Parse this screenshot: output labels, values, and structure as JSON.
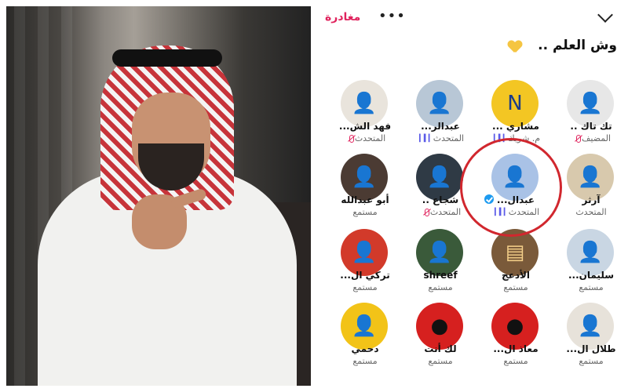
{
  "topbar": {
    "leave_label": "مغادرة",
    "more_label": "•••"
  },
  "space": {
    "title": "وش العلم .."
  },
  "participants": [
    {
      "name": "تك تاك ..",
      "role": "المضيف",
      "status": "muted",
      "avatar_color": "#e7e7e7",
      "avatar_fg": "#444444",
      "avatar_glyph": "👤"
    },
    {
      "name": "مشاري ...",
      "role": "م. شريك",
      "status": "speaking",
      "avatar_color": "#f3c623",
      "avatar_fg": "#1a3c8a",
      "avatar_glyph": "N"
    },
    {
      "name": "عبدالر...",
      "role": "المتحدث",
      "status": "speaking",
      "avatar_color": "#b8c7d6",
      "avatar_fg": "#2a2a2a",
      "avatar_glyph": "👤"
    },
    {
      "name": "فهد الش...",
      "role": "المتحدث",
      "status": "muted",
      "avatar_color": "#e9e4dc",
      "avatar_fg": "#333333",
      "avatar_glyph": "👤"
    },
    {
      "name": "آرثر",
      "role": "المتحدث",
      "status": "none",
      "avatar_color": "#d8c9ad",
      "avatar_fg": "#222222",
      "avatar_glyph": "👤"
    },
    {
      "name": "عبدال...",
      "role": "المتحدث",
      "status": "speaking",
      "avatar_color": "#a9c2e6",
      "avatar_fg": "#ffffff",
      "avatar_glyph": "👤",
      "verified": true
    },
    {
      "name": "شجاع ..",
      "role": "المتحدث",
      "status": "muted",
      "avatar_color": "#2f3a45",
      "avatar_fg": "#ffffff",
      "avatar_glyph": "👤"
    },
    {
      "name": "أبو عبدالله",
      "role": "مستمع",
      "status": "none",
      "avatar_color": "#4b3b33",
      "avatar_fg": "#ffffff",
      "avatar_glyph": "👤"
    },
    {
      "name": "سليمان...",
      "role": "مستمع",
      "status": "none",
      "avatar_color": "#c9d6e3",
      "avatar_fg": "#333333",
      "avatar_glyph": "👤"
    },
    {
      "name": "الأدعج",
      "role": "مستمع",
      "status": "none",
      "avatar_color": "#7a5a3a",
      "avatar_fg": "#f5d08a",
      "avatar_glyph": "▤"
    },
    {
      "name": "shreef",
      "role": "مستمع",
      "status": "none",
      "avatar_color": "#3a5a3a",
      "avatar_fg": "#f5d08a",
      "avatar_glyph": "👤"
    },
    {
      "name": "تركي ال...",
      "role": "مستمع",
      "status": "none",
      "avatar_color": "#d23a2a",
      "avatar_fg": "#ffffff",
      "avatar_glyph": "👤"
    },
    {
      "name": "طلال ال...",
      "role": "مستمع",
      "status": "none",
      "avatar_color": "#e7e2da",
      "avatar_fg": "#444444",
      "avatar_glyph": "👤"
    },
    {
      "name": "معاذ ال...",
      "role": "مستمع",
      "status": "none",
      "avatar_color": "#d6201f",
      "avatar_fg": "#111111",
      "avatar_glyph": "●"
    },
    {
      "name": "لك أنت",
      "role": "مستمع",
      "status": "none",
      "avatar_color": "#d6201f",
      "avatar_fg": "#111111",
      "avatar_glyph": "●"
    },
    {
      "name": "دحمي",
      "role": "مستمع",
      "status": "none",
      "avatar_color": "#f2c318",
      "avatar_fg": "#1a3c8a",
      "avatar_glyph": "👤"
    }
  ],
  "colors": {
    "accent": "#e0245e",
    "highlight": "#d1272e",
    "verified": "#1d9bf0"
  }
}
